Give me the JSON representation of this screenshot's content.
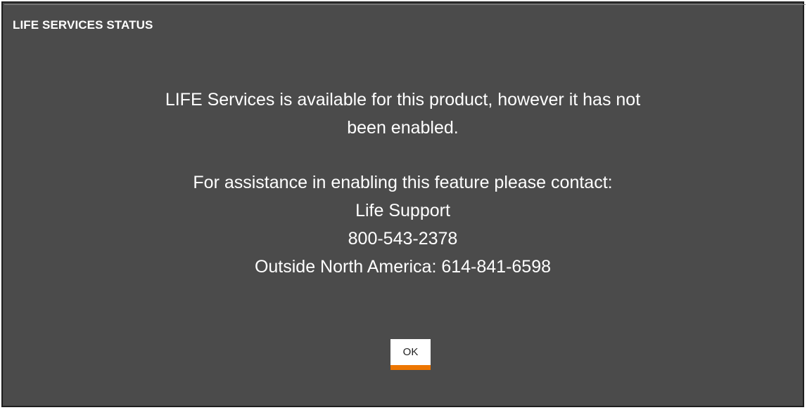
{
  "dialog": {
    "title": "LIFE SERVICES STATUS",
    "message": {
      "line1": "LIFE Services is available for this product, however it has not",
      "line2": "been enabled.",
      "line3": "For assistance in enabling this feature please contact:",
      "line4": "Life Support",
      "line5": "800-543-2378",
      "line6": "Outside North America: 614-841-6598"
    },
    "ok_label": "OK"
  },
  "colors": {
    "dialog_background": "#4b4b4b",
    "text": "#ffffff",
    "button_accent": "#ed7600"
  }
}
